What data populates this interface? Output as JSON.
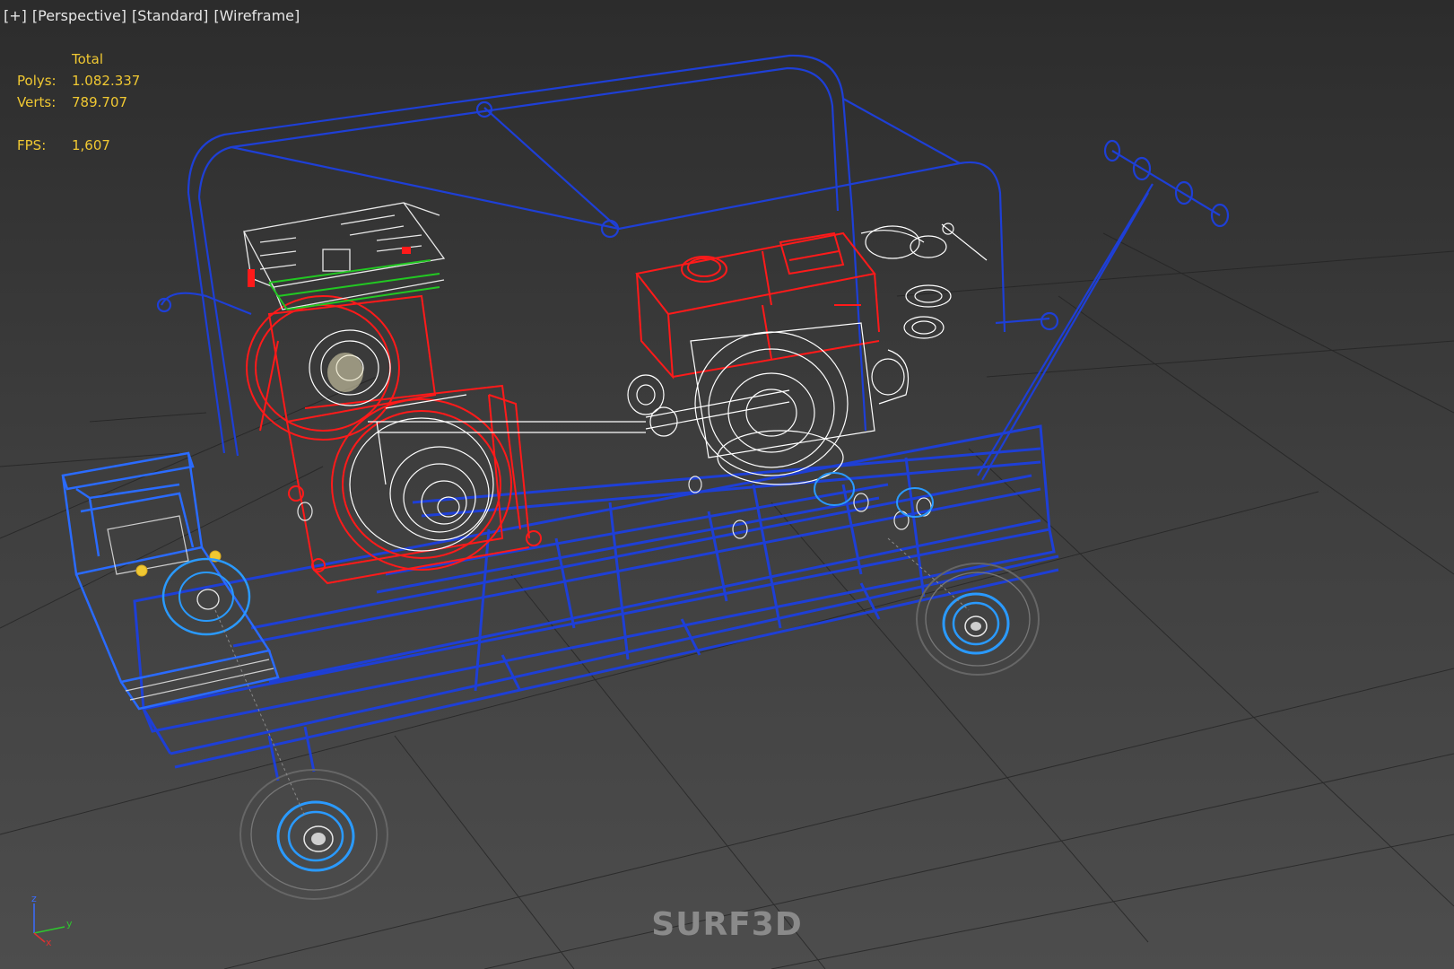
{
  "viewport": {
    "label_plus": "[+]",
    "label_view": "[Perspective]",
    "label_shading": "[Standard]",
    "label_mode": "[Wireframe]"
  },
  "stats": {
    "header": "Total",
    "polys_label": "Polys:",
    "polys_value": "1.082.337",
    "verts_label": "Verts:",
    "verts_value": "789.707",
    "fps_label": "FPS:",
    "fps_value": "1,607"
  },
  "watermark": "SURF3D",
  "axis_gizmo": {
    "x": "x",
    "y": "y",
    "z": "z"
  },
  "colors": {
    "stats_text": "#f0c832",
    "frame_wire": "#1e3fd6",
    "engine_wire": "#ff1a1a",
    "detail_wire": "#e8e8e8",
    "board_wire": "#22c822",
    "wheel_hub": "#2a9aff",
    "grid": "#1a1a1a"
  }
}
